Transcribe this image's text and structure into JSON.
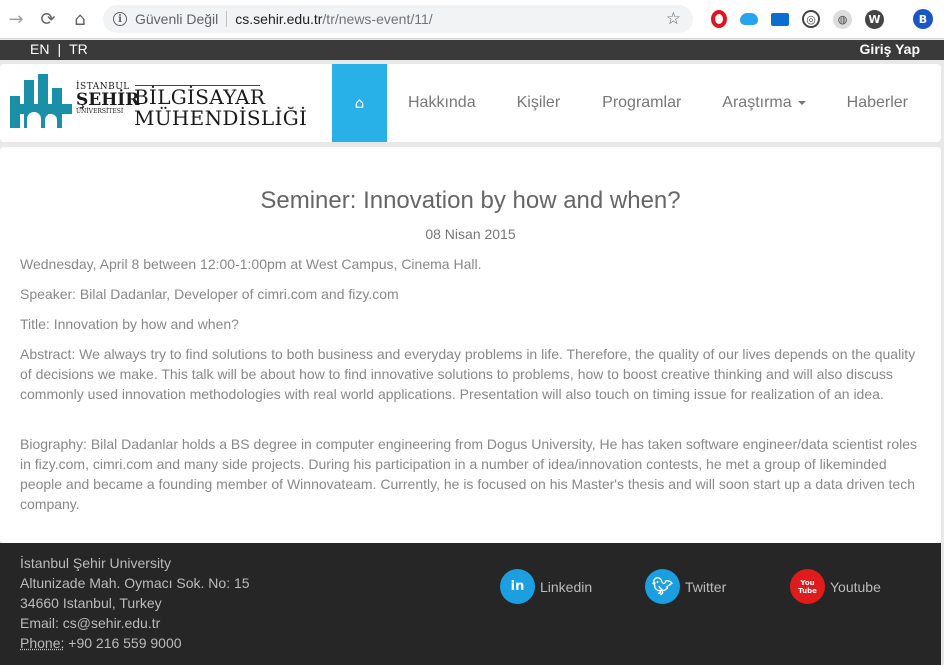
{
  "browser": {
    "security_label": "Güvenli Değil",
    "url_host": "cs.sehir.edu.tr",
    "url_path": "/tr/news-event/11/",
    "profile_initial": "B"
  },
  "topbar": {
    "lang_en": "EN",
    "lang_sep": "|",
    "lang_tr": "TR",
    "login": "Giriş Yap"
  },
  "logo": {
    "line1": "İSTANBUL",
    "line2": "ŞEHİR",
    "line3": "ÜNİVERSİTESİ",
    "right1": "BİLGİSAYAR",
    "right2": "MÜHENDİSLİĞİ"
  },
  "nav": {
    "items": [
      {
        "label": "Hakkında"
      },
      {
        "label": "Kişiler"
      },
      {
        "label": "Programlar"
      },
      {
        "label": "Araştırma"
      },
      {
        "label": "Haberler"
      }
    ]
  },
  "article": {
    "title": "Seminer: Innovation by how and when?",
    "date": "08 Nisan 2015",
    "paragraphs": [
      "Wednesday, April 8 between 12:00-1:00pm at West Campus, Cinema Hall.",
      "Speaker: Bilal Dadanlar, Developer of cimri.com and fizy.com",
      "Title: Innovation by how and when?",
      "Abstract: We always try to find solutions to both business and everyday problems in life. Therefore, the quality of our lives depends on the quality of decisions we make. This talk will be about how to find innovative solutions to problems, how to boost creative thinking and will also discuss commonly used innovation methodologies with real world applications. Presentation will also touch on timing issue for realization of an idea.",
      "Biography: Bilal Dadanlar holds a BS degree in computer engineering from Dogus University, He has taken software engineer/data scientist roles in fizy.com, cimri.com and many side projects. During his participation in a number of idea/innovation contests, he met a group of likeminded people and became a founding member of Winnovateam. Currently, he is focused on his Master's thesis and will soon start up a data driven tech company."
    ]
  },
  "footer": {
    "university": "İstanbul Şehir University",
    "street": "Altunizade Mah. Oymacı Sok. No: 15",
    "city": "34660 Istanbul, Turkey",
    "email": "Email: cs@sehir.edu.tr",
    "phone_label": "Phone:",
    "phone_value": " +90 216 559 9000",
    "social": [
      {
        "label": "Linkedin",
        "glyph": "in",
        "color": "#1b9fe0"
      },
      {
        "label": "Twitter",
        "glyph": "t",
        "color": "#1b9fe0"
      },
      {
        "label": "Youtube",
        "glyph": "You\nTube",
        "color": "#e01b1b"
      }
    ]
  }
}
